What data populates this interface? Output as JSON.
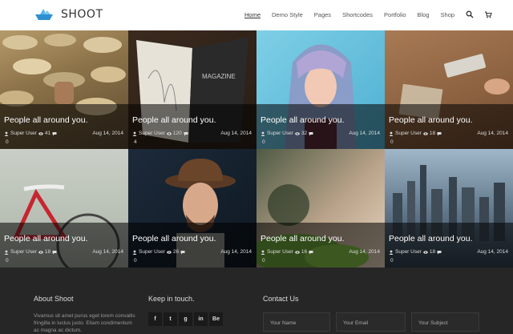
{
  "brand": {
    "name": "SHOOT",
    "accent": "#3aa3e3"
  },
  "nav": {
    "items": [
      {
        "label": "Home",
        "active": true
      },
      {
        "label": "Demo Style"
      },
      {
        "label": "Pages"
      },
      {
        "label": "Shortcodes"
      },
      {
        "label": "Portfolio"
      },
      {
        "label": "Blog"
      },
      {
        "label": "Shop"
      }
    ],
    "icons": [
      "search-icon",
      "cart-icon"
    ]
  },
  "posts": [
    {
      "title": "People all around you.",
      "author": "Super User",
      "views": "41",
      "date": "Aug 14, 2014",
      "comments": "0"
    },
    {
      "title": "People all around you.",
      "author": "Super User",
      "views": "120",
      "date": "Aug 14, 2014",
      "comments": "4"
    },
    {
      "title": "People all around you.",
      "author": "Super User",
      "views": "32",
      "date": "Aug 14, 2014",
      "comments": "0"
    },
    {
      "title": "People all around you.",
      "author": "Super User",
      "views": "18",
      "date": "Aug 14, 2014",
      "comments": "0"
    },
    {
      "title": "People all around you.",
      "author": "Super User",
      "views": "18",
      "date": "Aug 14, 2014",
      "comments": "0"
    },
    {
      "title": "People all around you.",
      "author": "Super User",
      "views": "26",
      "date": "Aug 14, 2014",
      "comments": "0"
    },
    {
      "title": "People all around you.",
      "author": "Super User",
      "views": "16",
      "date": "Aug 14, 2014",
      "comments": "0"
    },
    {
      "title": "People all around you.",
      "author": "Super User",
      "views": "18",
      "date": "Aug 14, 2014",
      "comments": "0"
    }
  ],
  "footer": {
    "about": {
      "title": "About Shoot",
      "text": "Vivamus sit amet purus eget lorem convallis fringilla in luctus justo. Etiam condimentum ac magna ac dictum."
    },
    "social": {
      "title": "Keep in touch.",
      "buttons": [
        "f",
        "t",
        "g",
        "in",
        "Be"
      ]
    },
    "contact": {
      "title": "Contact Us",
      "name_placeholder": "Your Name",
      "email_placeholder": "Your Email",
      "subject_placeholder": "Your Subject"
    }
  }
}
